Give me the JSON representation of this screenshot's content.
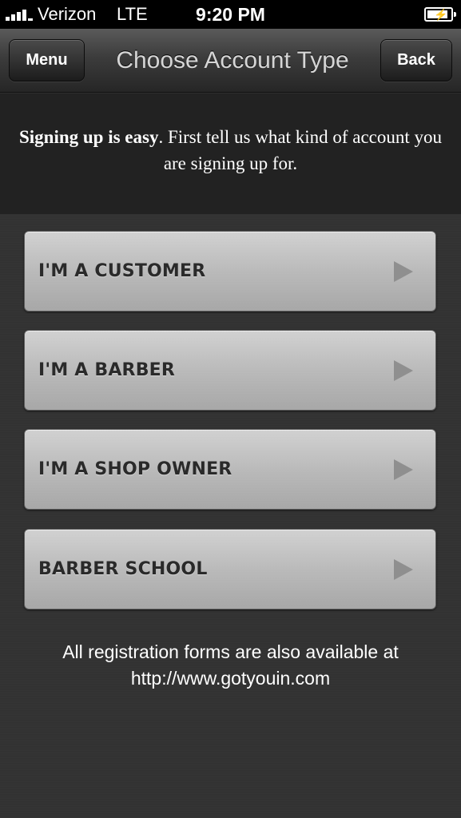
{
  "status_bar": {
    "carrier": "Verizon",
    "network": "LTE",
    "time": "9:20 PM",
    "battery_level": 0.9
  },
  "nav": {
    "menu_label": "Menu",
    "title": "Choose Account Type",
    "back_label": "Back"
  },
  "intro": {
    "bold_text": "Signing up is easy",
    "rest_text": ". First tell us what kind of account you are signing up for."
  },
  "options": [
    {
      "label": "I'M A CUSTOMER"
    },
    {
      "label": "I'M A BARBER"
    },
    {
      "label": "I'M A SHOP OWNER"
    },
    {
      "label": "BARBER SCHOOL"
    }
  ],
  "footer": {
    "line1": "All registration forms are also available at",
    "line2": "http://www.gotyouin.com"
  },
  "colors": {
    "background": "#2e2e2e",
    "option_text": "#2a2a2a",
    "arrow": "#8f8f8f"
  }
}
